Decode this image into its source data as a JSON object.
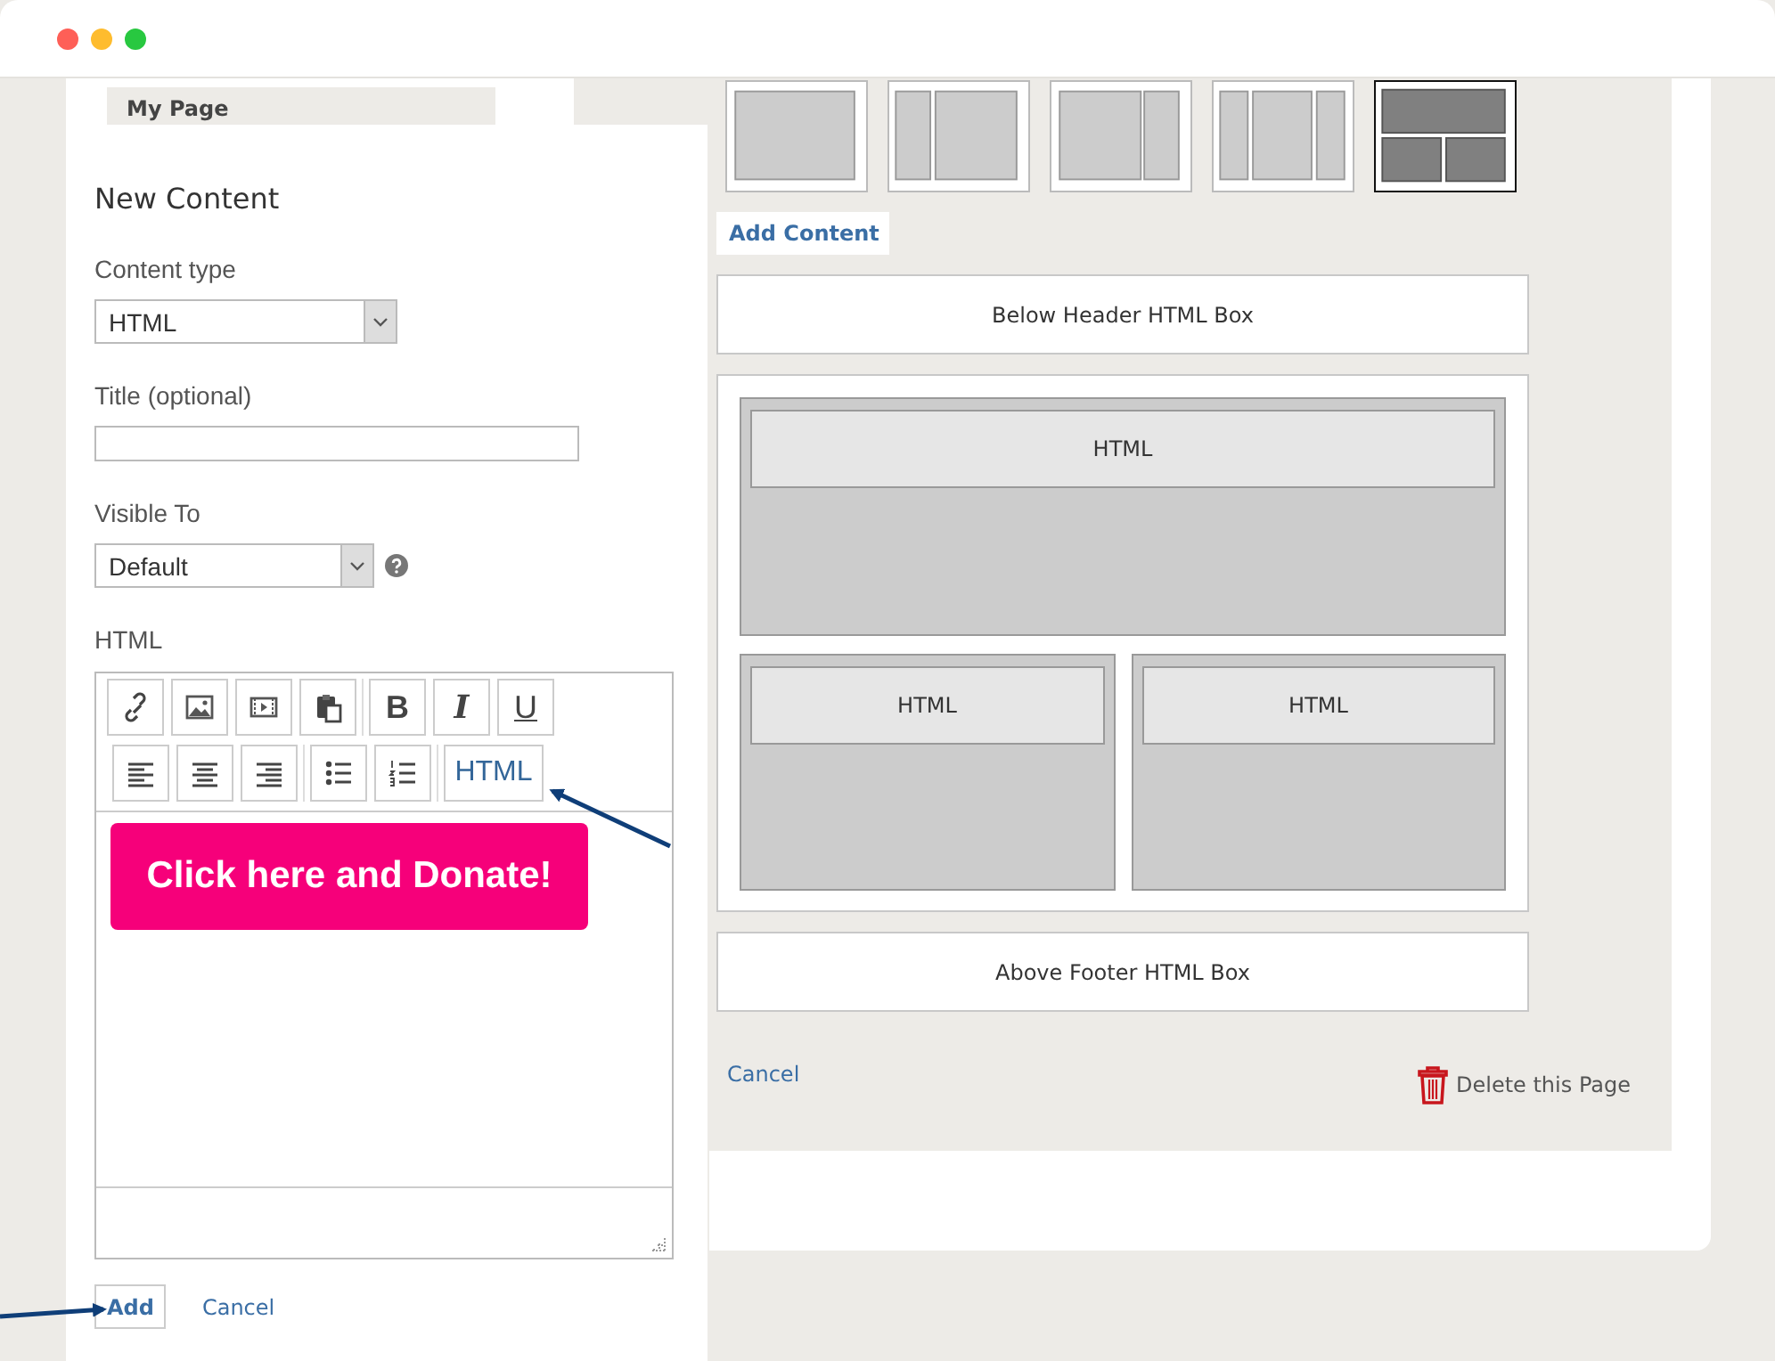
{
  "sidebar": {
    "items": [
      {
        "label": "My Page"
      }
    ]
  },
  "layouts": [
    {
      "kind": "single",
      "selected": false
    },
    {
      "kind": "left-sidebar",
      "selected": false
    },
    {
      "kind": "right-sidebar",
      "selected": false
    },
    {
      "kind": "three-column",
      "selected": false
    },
    {
      "kind": "header-split",
      "selected": true
    }
  ],
  "add_content_tab": {
    "label": "Add Content"
  },
  "preview": {
    "header_box": "Below Header HTML Box",
    "rows": [
      {
        "sections": [
          {
            "blocks": [
              "HTML"
            ]
          }
        ]
      },
      {
        "sections": [
          {
            "blocks": [
              "HTML"
            ]
          },
          {
            "blocks": [
              "HTML"
            ]
          }
        ]
      }
    ],
    "footer_box": "Above Footer HTML Box"
  },
  "page_actions": {
    "cancel": "Cancel",
    "delete": "Delete this Page"
  },
  "dialog": {
    "title": "New Content",
    "fields": [
      {
        "kind": "select",
        "label": "Content type",
        "value": "HTML"
      },
      {
        "kind": "text",
        "label": "Title (optional)"
      },
      {
        "kind": "select",
        "label": "Visible To",
        "value": "Default",
        "help": true
      }
    ],
    "editor": {
      "label": "HTML",
      "toolbar_rows": [
        {
          "groups": [
            [
              {
                "kind": "link"
              },
              {
                "kind": "image"
              },
              {
                "kind": "video"
              },
              {
                "kind": "paste"
              }
            ],
            [
              {
                "kind": "bold",
                "label": "B"
              },
              {
                "kind": "italic",
                "label": "I"
              },
              {
                "kind": "underline",
                "label": "U"
              }
            ]
          ]
        },
        {
          "groups": [
            [
              {
                "kind": "align-left"
              },
              {
                "kind": "align-center"
              },
              {
                "kind": "align-right"
              }
            ],
            [
              {
                "kind": "bullet-list"
              },
              {
                "kind": "numbered-list"
              }
            ],
            [
              {
                "kind": "source",
                "label": "HTML"
              }
            ]
          ]
        }
      ],
      "content_button": "Click here and Donate!"
    },
    "buttons": {
      "add": "Add",
      "cancel": "Cancel"
    }
  }
}
